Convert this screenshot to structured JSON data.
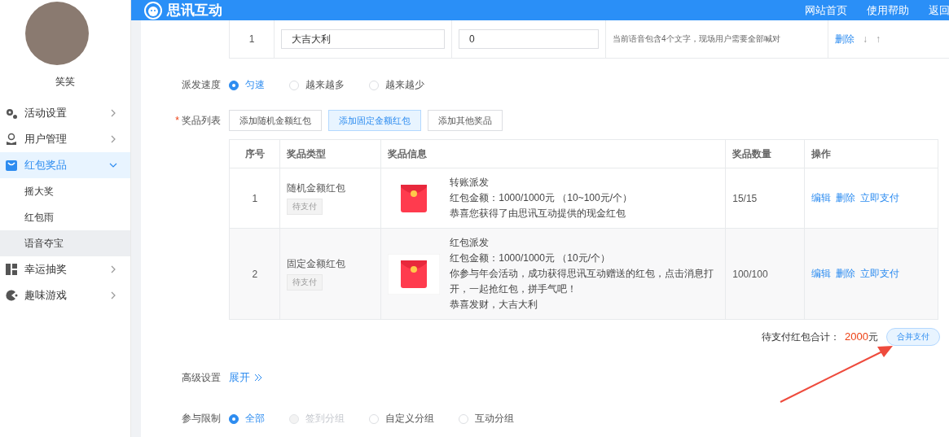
{
  "header": {
    "logo_text": "思讯互动",
    "nav": [
      "网站首页",
      "使用帮助",
      "返回"
    ]
  },
  "sidebar": {
    "user_name": "笑笑",
    "items": [
      {
        "label": "活动设置",
        "selected": false,
        "expanded": false
      },
      {
        "label": "用户管理",
        "selected": false,
        "expanded": false
      },
      {
        "label": "红包奖品",
        "selected": true,
        "expanded": true,
        "children": [
          {
            "label": "摇大奖",
            "selected": false
          },
          {
            "label": "红包雨",
            "selected": false
          },
          {
            "label": "语音夺宝",
            "selected": true
          }
        ]
      },
      {
        "label": "幸运抽奖",
        "selected": false,
        "expanded": false
      },
      {
        "label": "趣味游戏",
        "selected": false,
        "expanded": false
      }
    ]
  },
  "voice_row": {
    "index": "1",
    "word": "大吉大利",
    "value": "0",
    "hint": "当前语音包含4个文字，现场用户需要全部喊对",
    "delete": "删除",
    "down": "↓",
    "up": "↑"
  },
  "speed": {
    "label": "派发速度",
    "options": [
      {
        "label": "匀速",
        "selected": true,
        "disabled": false
      },
      {
        "label": "越来越多",
        "selected": false,
        "disabled": false
      },
      {
        "label": "越来越少",
        "selected": false,
        "disabled": false
      }
    ]
  },
  "prize_list": {
    "label": "奖品列表",
    "required_mark": "*",
    "add_buttons": [
      {
        "label": "添加随机金额红包",
        "selected": false
      },
      {
        "label": "添加固定金额红包",
        "selected": true
      },
      {
        "label": "添加其他奖品",
        "selected": false
      }
    ],
    "columns": [
      "序号",
      "奖品类型",
      "奖品信息",
      "奖品数量",
      "操作"
    ],
    "rows": [
      {
        "index": "1",
        "type": "随机金额红包",
        "status": "待支付",
        "info": [
          "转账派发",
          "红包金额：1000/1000元 （10~100元/个）",
          "恭喜您获得了由思讯互动提供的现金红包"
        ],
        "quantity": "15/15",
        "actions": [
          "编辑",
          "删除",
          "立即支付"
        ],
        "selected": false
      },
      {
        "index": "2",
        "type": "固定金额红包",
        "status": "待支付",
        "info": [
          "红包派发",
          "红包金额：1000/1000元 （10元/个）",
          "你参与年会活动，成功获得思讯互动赠送的红包，点击消息打开，一起抢红包，拼手气吧！",
          "恭喜发财，大吉大利"
        ],
        "quantity": "100/100",
        "actions": [
          "编辑",
          "删除",
          "立即支付"
        ],
        "selected": true
      }
    ]
  },
  "total": {
    "label": "待支付红包合计：",
    "amount": "2000",
    "unit": "元",
    "pay_button": "合并支付"
  },
  "advanced": {
    "label": "高级设置",
    "toggle": "展开"
  },
  "participation": {
    "label": "参与限制",
    "options": [
      {
        "label": "全部",
        "selected": true,
        "disabled": false
      },
      {
        "label": "签到分组",
        "selected": false,
        "disabled": true
      },
      {
        "label": "自定义分组",
        "selected": false,
        "disabled": false
      },
      {
        "label": "互动分组",
        "selected": false,
        "disabled": false
      }
    ]
  }
}
